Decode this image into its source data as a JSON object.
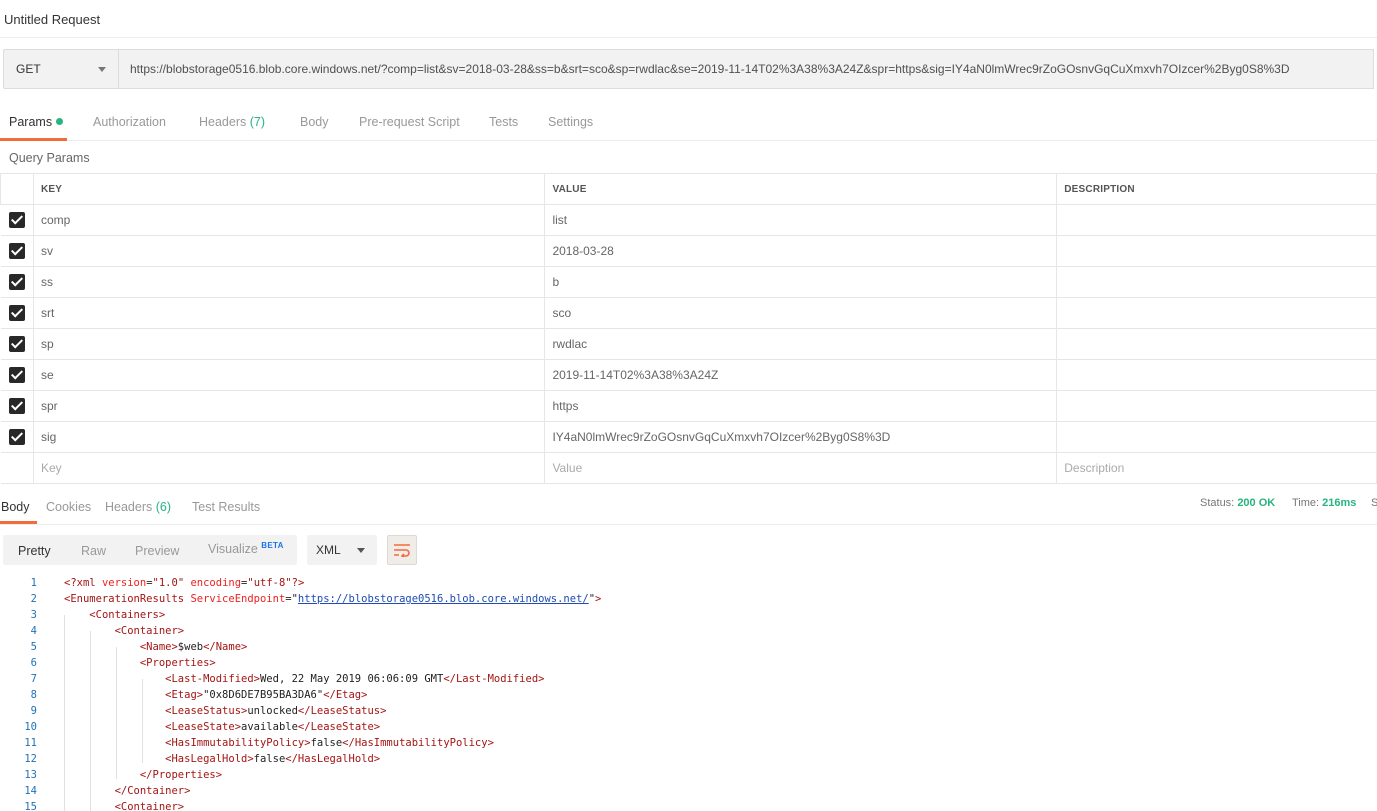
{
  "window": {
    "title": "Untitled Request"
  },
  "request": {
    "method": "GET",
    "url": "https://blobstorage0516.blob.core.windows.net/?comp=list&sv=2018-03-28&ss=b&srt=sco&sp=rwdlac&se=2019-11-14T02%3A38%3A24Z&spr=https&sig=IY4aN0lmWrec9rZoGOsnvGqCuXmxvh7OIzcer%2Byg0S8%3D"
  },
  "request_tabs": {
    "params": "Params",
    "authorization": "Authorization",
    "headers": "Headers",
    "headers_count": "(7)",
    "body": "Body",
    "pre_request": "Pre-request Script",
    "tests": "Tests",
    "settings": "Settings"
  },
  "query_params": {
    "section_label": "Query Params",
    "columns": {
      "key": "KEY",
      "value": "VALUE",
      "description": "DESCRIPTION"
    },
    "rows": [
      {
        "key": "comp",
        "value": "list",
        "description": ""
      },
      {
        "key": "sv",
        "value": "2018-03-28",
        "description": ""
      },
      {
        "key": "ss",
        "value": "b",
        "description": ""
      },
      {
        "key": "srt",
        "value": "sco",
        "description": ""
      },
      {
        "key": "sp",
        "value": "rwdlac",
        "description": ""
      },
      {
        "key": "se",
        "value": "2019-11-14T02%3A38%3A24Z",
        "description": ""
      },
      {
        "key": "spr",
        "value": "https",
        "description": ""
      },
      {
        "key": "sig",
        "value": "IY4aN0lmWrec9rZoGOsnvGqCuXmxvh7OIzcer%2Byg0S8%3D",
        "description": ""
      }
    ],
    "placeholders": {
      "key": "Key",
      "value": "Value",
      "description": "Description"
    }
  },
  "response_tabs": {
    "body": "Body",
    "cookies": "Cookies",
    "headers": "Headers",
    "headers_count": "(6)",
    "test_results": "Test Results"
  },
  "response_status": {
    "status_label": "Status:",
    "status_value": "200 OK",
    "time_label": "Time:",
    "time_value": "216ms",
    "size_label": "S"
  },
  "view_modes": {
    "pretty": "Pretty",
    "raw": "Raw",
    "preview": "Preview",
    "visualize": "Visualize",
    "visualize_badge": "BETA",
    "format": "XML"
  },
  "icons": {
    "method_caret": "chevron-down-icon",
    "format_caret": "chevron-down-icon",
    "wrap": "wrap-lines-icon",
    "check": "checkbox-checked-icon"
  },
  "colors": {
    "accent": "#f26b3a",
    "success": "#26b47f",
    "line_number": "#1f72b8",
    "tag": "#a31515",
    "attribute": "#ee2222"
  },
  "code_lines": [
    {
      "n": "1",
      "parts": [
        {
          "c": "tag",
          "t": "<?xml "
        },
        {
          "c": "attr",
          "t": "version"
        },
        {
          "c": "txt",
          "t": "="
        },
        {
          "c": "val",
          "t": "\"1.0\""
        },
        {
          "c": "txt",
          "t": " "
        },
        {
          "c": "attr",
          "t": "encoding"
        },
        {
          "c": "txt",
          "t": "="
        },
        {
          "c": "val",
          "t": "\"utf-8\""
        },
        {
          "c": "tag",
          "t": "?>"
        }
      ]
    },
    {
      "n": "2",
      "parts": [
        {
          "c": "tag",
          "t": "<EnumerationResults "
        },
        {
          "c": "attr",
          "t": "ServiceEndpoint"
        },
        {
          "c": "txt",
          "t": "=\""
        },
        {
          "c": "lnk",
          "t": "https://blobstorage0516.blob.core.windows.net/"
        },
        {
          "c": "txt",
          "t": "\""
        },
        {
          "c": "tag",
          "t": ">"
        }
      ]
    },
    {
      "n": "3",
      "parts": [
        {
          "c": "txt",
          "t": "    "
        },
        {
          "c": "tag",
          "t": "<Containers>"
        }
      ]
    },
    {
      "n": "4",
      "parts": [
        {
          "c": "txt",
          "t": "        "
        },
        {
          "c": "tag",
          "t": "<Container>"
        }
      ]
    },
    {
      "n": "5",
      "parts": [
        {
          "c": "txt",
          "t": "            "
        },
        {
          "c": "tag",
          "t": "<Name>"
        },
        {
          "c": "txt",
          "t": "$web"
        },
        {
          "c": "tag",
          "t": "</Name>"
        }
      ]
    },
    {
      "n": "6",
      "parts": [
        {
          "c": "txt",
          "t": "            "
        },
        {
          "c": "tag",
          "t": "<Properties>"
        }
      ]
    },
    {
      "n": "7",
      "parts": [
        {
          "c": "txt",
          "t": "                "
        },
        {
          "c": "tag",
          "t": "<Last-Modified>"
        },
        {
          "c": "txt",
          "t": "Wed, 22 May 2019 06:06:09 GMT"
        },
        {
          "c": "tag",
          "t": "</Last-Modified>"
        }
      ]
    },
    {
      "n": "8",
      "parts": [
        {
          "c": "txt",
          "t": "                "
        },
        {
          "c": "tag",
          "t": "<Etag>"
        },
        {
          "c": "txt",
          "t": "\"0x8D6DE7B95BA3DA6\""
        },
        {
          "c": "tag",
          "t": "</Etag>"
        }
      ]
    },
    {
      "n": "9",
      "parts": [
        {
          "c": "txt",
          "t": "                "
        },
        {
          "c": "tag",
          "t": "<LeaseStatus>"
        },
        {
          "c": "txt",
          "t": "unlocked"
        },
        {
          "c": "tag",
          "t": "</LeaseStatus>"
        }
      ]
    },
    {
      "n": "10",
      "parts": [
        {
          "c": "txt",
          "t": "                "
        },
        {
          "c": "tag",
          "t": "<LeaseState>"
        },
        {
          "c": "txt",
          "t": "available"
        },
        {
          "c": "tag",
          "t": "</LeaseState>"
        }
      ]
    },
    {
      "n": "11",
      "parts": [
        {
          "c": "txt",
          "t": "                "
        },
        {
          "c": "tag",
          "t": "<HasImmutabilityPolicy>"
        },
        {
          "c": "txt",
          "t": "false"
        },
        {
          "c": "tag",
          "t": "</HasImmutabilityPolicy>"
        }
      ]
    },
    {
      "n": "12",
      "parts": [
        {
          "c": "txt",
          "t": "                "
        },
        {
          "c": "tag",
          "t": "<HasLegalHold>"
        },
        {
          "c": "txt",
          "t": "false"
        },
        {
          "c": "tag",
          "t": "</HasLegalHold>"
        }
      ]
    },
    {
      "n": "13",
      "parts": [
        {
          "c": "txt",
          "t": "            "
        },
        {
          "c": "tag",
          "t": "</Properties>"
        }
      ]
    },
    {
      "n": "14",
      "parts": [
        {
          "c": "txt",
          "t": "        "
        },
        {
          "c": "tag",
          "t": "</Container>"
        }
      ]
    },
    {
      "n": "15",
      "parts": [
        {
          "c": "txt",
          "t": "        "
        },
        {
          "c": "tag",
          "t": "<Container>"
        }
      ]
    }
  ]
}
